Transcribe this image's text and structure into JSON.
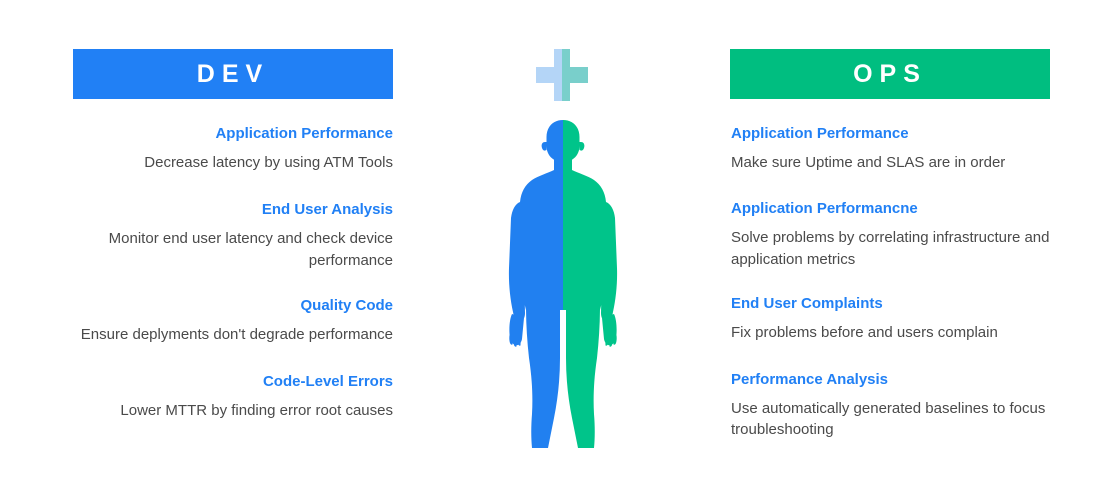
{
  "dev": {
    "header": {
      "label": "DEV",
      "background_color": "#2180f5",
      "text_color": "#ffffff"
    },
    "entries": [
      {
        "title": "Application Performance",
        "description": "Decrease latency by using ATM Tools"
      },
      {
        "title": "End User Analysis",
        "description": "Monitor end user latency and check device performance"
      },
      {
        "title": "Quality Code",
        "description": "Ensure deplyments don't degrade performance"
      },
      {
        "title": "Code-Level Errors",
        "description": "Lower MTTR by finding error root causes"
      }
    ]
  },
  "ops": {
    "header": {
      "label": "OPS",
      "background_color": "#00be80",
      "text_color": "#ffffff"
    },
    "entries": [
      {
        "title": "Application Performance",
        "description": "Make sure Uptime and SLAS are in order"
      },
      {
        "title": "Application Performancne",
        "description": "Solve problems by correlating infrastructure and application metrics"
      },
      {
        "title": "End User Complaints",
        "description": "Fix problems before and users complain"
      },
      {
        "title": "Performance Analysis",
        "description": "Use automatically generated baselines to focus troubleshooting"
      }
    ]
  },
  "center": {
    "plus_icon": {
      "name": "plus-icon",
      "left_half_color": "#b4d5f7",
      "right_half_color": "#79cfcb"
    },
    "human_figure": {
      "name": "human-figure-icon",
      "left_half_color": "#2180f0",
      "right_half_color": "#00c48a"
    }
  },
  "theme": {
    "title_color": "#2180f5",
    "body_text_color": "#4a4a4a",
    "page_background": "#ffffff"
  }
}
